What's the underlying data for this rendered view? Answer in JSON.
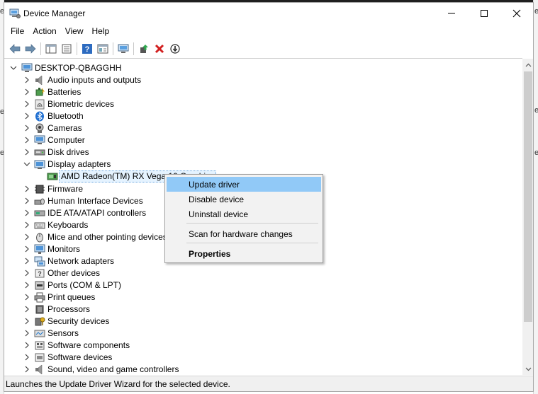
{
  "window": {
    "title": "Device Manager",
    "controls": [
      "minimize-icon",
      "maximize-icon",
      "close-icon"
    ]
  },
  "menu": {
    "items": [
      "File",
      "Action",
      "View",
      "Help"
    ]
  },
  "toolbar": {
    "buttons": [
      "back-arrow-icon",
      "forward-arrow-icon",
      "show-hide-console-tree-icon",
      "properties-icon",
      "help-icon",
      "view-icon",
      "scan-hardware-icon",
      "update-driver-icon",
      "uninstall-icon",
      "disable-device-icon"
    ]
  },
  "tree": {
    "root": "DESKTOP-QBAGGHH",
    "selected_child": "AMD Radeon(TM) RX Vega 10 Graphics",
    "categories": [
      {
        "label": "Audio inputs and outputs",
        "icon": "speaker-icon"
      },
      {
        "label": "Batteries",
        "icon": "battery-icon"
      },
      {
        "label": "Biometric devices",
        "icon": "fingerprint-icon"
      },
      {
        "label": "Bluetooth",
        "icon": "bluetooth-icon"
      },
      {
        "label": "Cameras",
        "icon": "camera-icon"
      },
      {
        "label": "Computer",
        "icon": "computer-icon"
      },
      {
        "label": "Disk drives",
        "icon": "disk-drive-icon"
      },
      {
        "label": "Display adapters",
        "icon": "display-adapter-icon",
        "expanded": true
      },
      {
        "label": "Firmware",
        "icon": "firmware-icon"
      },
      {
        "label": "Human Interface Devices",
        "icon": "hid-icon"
      },
      {
        "label": "IDE ATA/ATAPI controllers",
        "icon": "ide-controller-icon"
      },
      {
        "label": "Keyboards",
        "icon": "keyboard-icon"
      },
      {
        "label": "Mice and other pointing devices",
        "icon": "mouse-icon"
      },
      {
        "label": "Monitors",
        "icon": "monitor-icon"
      },
      {
        "label": "Network adapters",
        "icon": "network-adapter-icon"
      },
      {
        "label": "Other devices",
        "icon": "unknown-device-icon"
      },
      {
        "label": "Ports (COM & LPT)",
        "icon": "port-icon"
      },
      {
        "label": "Print queues",
        "icon": "printer-icon"
      },
      {
        "label": "Processors",
        "icon": "processor-icon"
      },
      {
        "label": "Security devices",
        "icon": "security-key-icon"
      },
      {
        "label": "Sensors",
        "icon": "sensor-icon"
      },
      {
        "label": "Software components",
        "icon": "software-component-icon"
      },
      {
        "label": "Software devices",
        "icon": "software-device-icon"
      },
      {
        "label": "Sound, video and game controllers",
        "icon": "sound-controller-icon"
      }
    ]
  },
  "context_menu": {
    "items": [
      {
        "label": "Update driver",
        "highlighted": true
      },
      {
        "label": "Disable device"
      },
      {
        "label": "Uninstall device"
      },
      {
        "label": "Scan for hardware changes"
      },
      {
        "label": "Properties",
        "bold": true
      }
    ]
  },
  "status": {
    "text": "Launches the Update Driver Wizard for the selected device."
  },
  "colors": {
    "menu_highlight": "#91c9f7",
    "selection_fill": "#e5f3ff",
    "status_bar": "#f0f0f0"
  }
}
